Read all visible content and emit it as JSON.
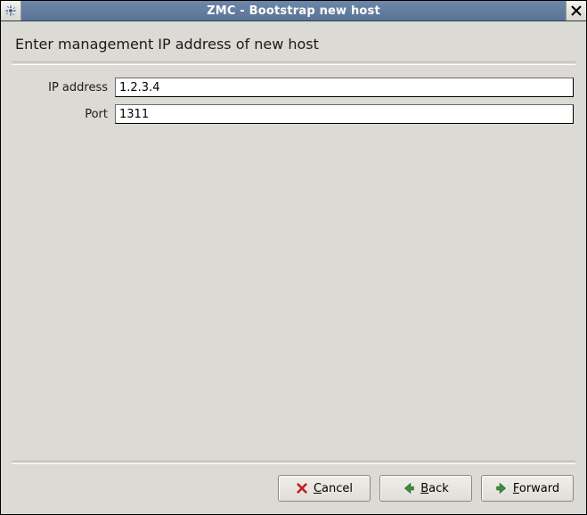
{
  "window": {
    "title": "ZMC - Bootstrap new host"
  },
  "heading": "Enter management IP address of new host",
  "form": {
    "ip_label": "IP address",
    "ip_value": "1.2.3.4",
    "port_label": "Port",
    "port_value": "1311"
  },
  "buttons": {
    "cancel_pre": "",
    "cancel_mn": "C",
    "cancel_post": "ancel",
    "back_pre": "",
    "back_mn": "B",
    "back_post": "ack",
    "forward_pre": "",
    "forward_mn": "F",
    "forward_post": "orward"
  }
}
